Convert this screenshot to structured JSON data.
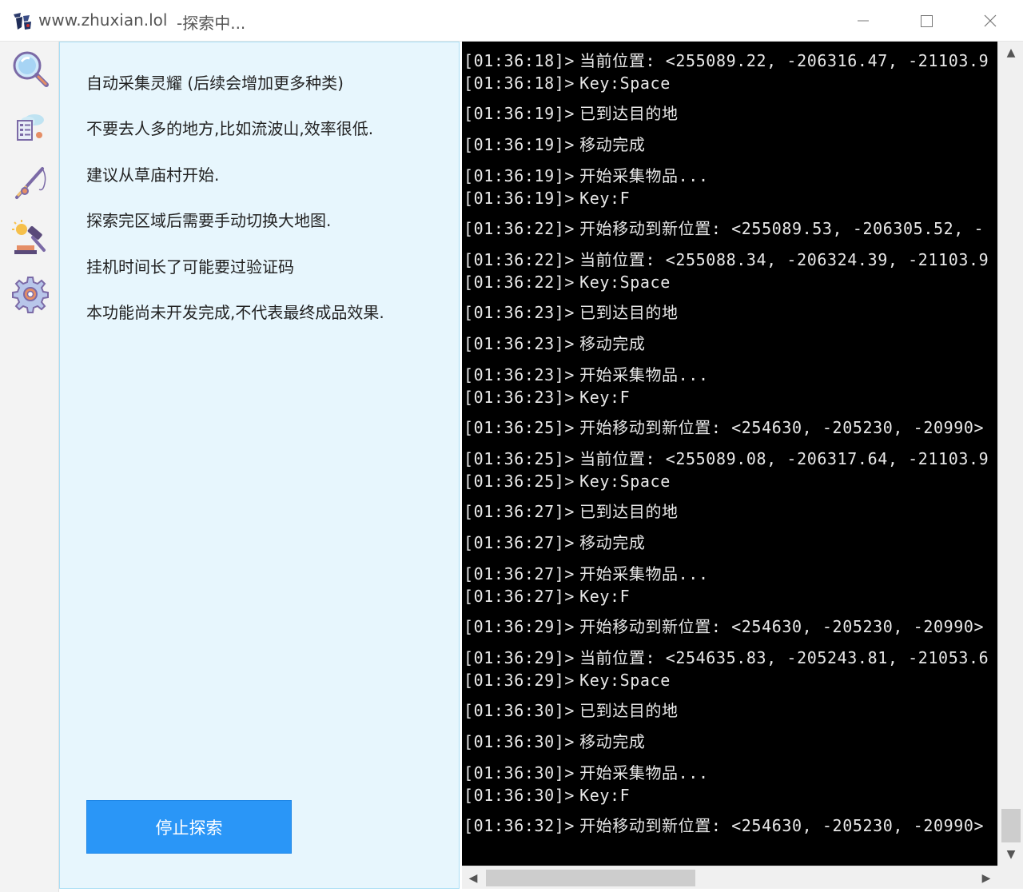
{
  "window": {
    "title": "www.zhuxian.lol",
    "status": "-探索中...",
    "minimize_glyph": "—",
    "maximize_glyph": "☐",
    "close_glyph": "✕"
  },
  "sidebar": {
    "items": [
      {
        "name": "magnifier-icon"
      },
      {
        "name": "task-list-cloud-icon"
      },
      {
        "name": "fishing-rod-icon"
      },
      {
        "name": "auction-gavel-icon"
      },
      {
        "name": "gear-icon"
      }
    ]
  },
  "info": {
    "lines": [
      "自动采集灵耀 (后续会增加更多种类)",
      "不要去人多的地方,比如流波山,效率很低.",
      "建议从草庙村开始.",
      "探索完区域后需要手动切换大地图.",
      "挂机时间长了可能要过验证码",
      "本功能尚未开发完成,不代表最终成品效果."
    ],
    "stop_button": "停止探索"
  },
  "console": {
    "lines": [
      {
        "t": "[01:36:18]>",
        "m": "当前位置: <255089.22, -206316.47, -21103.9"
      },
      {
        "t": "[01:36:18]>",
        "m": "Key:Space"
      },
      {
        "t": "[01:36:19]>",
        "m": "已到达目的地"
      },
      {
        "t": "[01:36:19]>",
        "m": "移动完成"
      },
      {
        "t": "[01:36:19]>",
        "m": "开始采集物品..."
      },
      {
        "t": "[01:36:19]>",
        "m": "Key:F"
      },
      {
        "t": "[01:36:22]>",
        "m": "开始移动到新位置: <255089.53, -206305.52, -"
      },
      {
        "t": "[01:36:22]>",
        "m": "当前位置: <255088.34, -206324.39, -21103.9"
      },
      {
        "t": "[01:36:22]>",
        "m": "Key:Space"
      },
      {
        "t": "[01:36:23]>",
        "m": "已到达目的地"
      },
      {
        "t": "[01:36:23]>",
        "m": "移动完成"
      },
      {
        "t": "[01:36:23]>",
        "m": "开始采集物品..."
      },
      {
        "t": "[01:36:23]>",
        "m": "Key:F"
      },
      {
        "t": "[01:36:25]>",
        "m": "开始移动到新位置: <254630, -205230, -20990>"
      },
      {
        "t": "[01:36:25]>",
        "m": "当前位置: <255089.08, -206317.64, -21103.9"
      },
      {
        "t": "[01:36:25]>",
        "m": "Key:Space"
      },
      {
        "t": "[01:36:27]>",
        "m": "已到达目的地"
      },
      {
        "t": "[01:36:27]>",
        "m": "移动完成"
      },
      {
        "t": "[01:36:27]>",
        "m": "开始采集物品..."
      },
      {
        "t": "[01:36:27]>",
        "m": "Key:F"
      },
      {
        "t": "[01:36:29]>",
        "m": "开始移动到新位置: <254630, -205230, -20990>"
      },
      {
        "t": "[01:36:29]>",
        "m": "当前位置: <254635.83, -205243.81, -21053.6"
      },
      {
        "t": "[01:36:29]>",
        "m": "Key:Space"
      },
      {
        "t": "[01:36:30]>",
        "m": "已到达目的地"
      },
      {
        "t": "[01:36:30]>",
        "m": "移动完成"
      },
      {
        "t": "[01:36:30]>",
        "m": "开始采集物品..."
      },
      {
        "t": "[01:36:30]>",
        "m": "Key:F"
      },
      {
        "t": "[01:36:32]>",
        "m": "开始移动到新位置: <254630, -205230, -20990>"
      }
    ]
  },
  "scrollbars": {
    "up": "▲",
    "down": "▼",
    "left": "◀",
    "right": "▶"
  }
}
